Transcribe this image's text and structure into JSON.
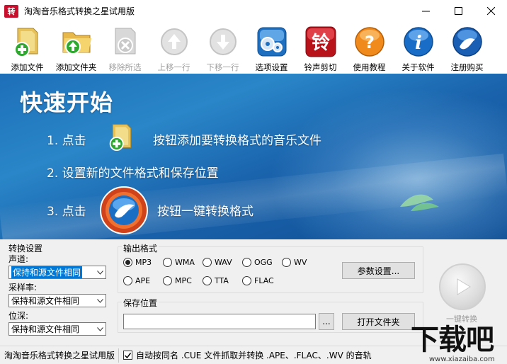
{
  "window": {
    "icon_text": "转",
    "title": "淘淘音乐格式转换之星试用版"
  },
  "toolbar": {
    "items": [
      {
        "label": "添加文件",
        "icon": "add-file-icon",
        "enabled": true
      },
      {
        "label": "添加文件夹",
        "icon": "add-folder-icon",
        "enabled": true
      },
      {
        "label": "移除所选",
        "icon": "remove-icon",
        "enabled": false
      },
      {
        "label": "上移一行",
        "icon": "move-up-icon",
        "enabled": false
      },
      {
        "label": "下移一行",
        "icon": "move-down-icon",
        "enabled": false
      },
      {
        "label": "选项设置",
        "icon": "options-icon",
        "enabled": true
      },
      {
        "label": "铃声剪切",
        "icon": "ringtone-icon",
        "enabled": true,
        "icon_text": "铃"
      },
      {
        "label": "使用教程",
        "icon": "help-icon",
        "enabled": true,
        "icon_text": "?"
      },
      {
        "label": "关于软件",
        "icon": "info-icon",
        "enabled": true,
        "icon_text": "i"
      },
      {
        "label": "注册购买",
        "icon": "register-icon",
        "enabled": true
      }
    ]
  },
  "banner": {
    "title": "快速开始",
    "step1_prefix": "1. 点击",
    "step1_suffix": "按钮添加要转换格式的音乐文件",
    "step2": "2. 设置新的文件格式和保存位置",
    "step3_prefix": "3. 点击",
    "step3_suffix": "按钮一键转换格式"
  },
  "settings": {
    "section_label": "转换设置",
    "channel_label": "声道:",
    "channel_value": "保持和源文件相同",
    "samplerate_label": "采样率:",
    "samplerate_value": "保持和源文件相同",
    "bitdepth_label": "位深:",
    "bitdepth_value": "保持和源文件相同"
  },
  "output": {
    "label": "输出格式",
    "formats": [
      "MP3",
      "WMA",
      "WAV",
      "OGG",
      "WV",
      "APE",
      "MPC",
      "TTA",
      "FLAC"
    ],
    "selected": "MP3",
    "params_button": "参数设置..."
  },
  "save": {
    "label": "保存位置",
    "path_value": "",
    "browse_button": "...",
    "open_folder_button": "打开文件夹"
  },
  "convert": {
    "label": "一键转换"
  },
  "status": {
    "app_name": "淘淘音乐格式转换之星试用版",
    "cue_option": "自动按同名 .CUE 文件抓取并转换 .APE、.FLAC、.WV 的音轨",
    "cue_checked": true
  },
  "watermark": {
    "main": "下载吧",
    "sub": "www.xiazaiba.com"
  },
  "colors": {
    "banner": "#1a64ad",
    "panel": "#f0f0f0",
    "selection": "#0078d7"
  }
}
